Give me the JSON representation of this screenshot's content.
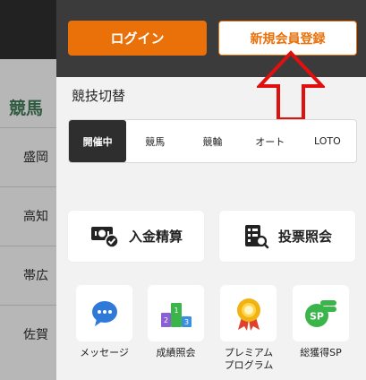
{
  "background_page": {
    "section_title": "競馬",
    "rows": [
      "盛岡",
      "高知",
      "帯広",
      "佐賀"
    ]
  },
  "drawer": {
    "login_label": "ログイン",
    "signup_label": "新規会員登録",
    "sport_switch_label": "競技切替",
    "sport_tabs": [
      "開催中",
      "競馬",
      "競輪",
      "オート",
      "LOTO"
    ],
    "big_actions": [
      {
        "label": "入金精算",
        "icon": "money-check-icon"
      },
      {
        "label": "投票照会",
        "icon": "ballot-search-icon"
      }
    ],
    "small_actions": [
      {
        "label": "メッセージ",
        "icon": "chat-bubble-icon"
      },
      {
        "label": "成績照会",
        "icon": "podium-icon"
      },
      {
        "label": "プレミアム\nプログラム",
        "icon": "medal-icon"
      },
      {
        "label": "総獲得SP",
        "icon": "sp-coin-icon"
      }
    ]
  },
  "colors": {
    "accent_orange": "#ea7009",
    "annotation_red": "#e01010",
    "active_tab": "#2e2e2e"
  }
}
